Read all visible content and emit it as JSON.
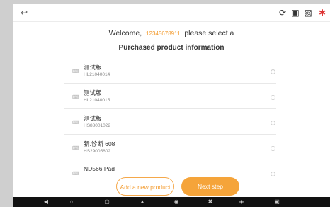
{
  "topbar": {
    "back_icon": "back-arrow-icon",
    "status_icons": [
      "refresh-icon",
      "camera-icon",
      "screenshot-icon",
      "bluetooth-icon"
    ]
  },
  "welcome": {
    "prefix": "Welcome,",
    "phone": "12345678911",
    "suffix": "please select a"
  },
  "subtitle": "Purchased product information",
  "products": [
    {
      "name": "测试版",
      "serial": "HL21040014"
    },
    {
      "name": "测试版",
      "serial": "HL21040015"
    },
    {
      "name": "测试版",
      "serial": "HS88001022"
    },
    {
      "name": "新.诊断 608",
      "serial": "HS29005602"
    },
    {
      "name": "ND566 Pad",
      "serial": ""
    }
  ],
  "buttons": {
    "add_label": "Add a new product",
    "next_label": "Next step"
  },
  "navbar": {
    "icons": [
      "nav-back-icon",
      "nav-home-icon",
      "nav-recents-icon",
      "nav-car-icon",
      "nav-vehicle-icon",
      "nav-tools-icon",
      "nav-shield-icon",
      "nav-screenshot-icon"
    ]
  },
  "colors": {
    "accent": "#f5a43a",
    "phone": "#f39a2c",
    "navbar": "#111111"
  }
}
